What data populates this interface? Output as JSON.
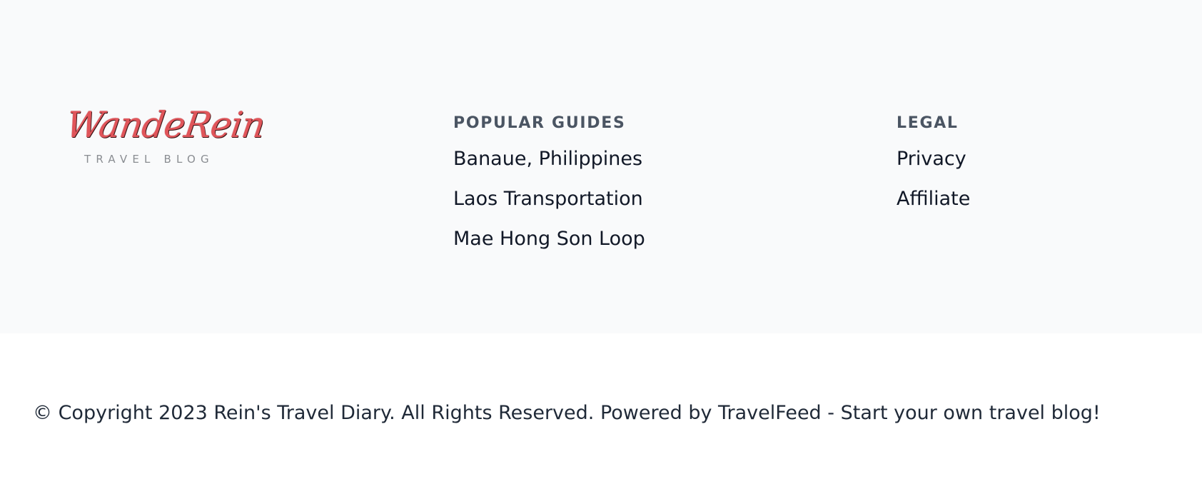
{
  "brand": {
    "logo_text": "WandeRein",
    "logo_subtext": "TRAVEL BLOG",
    "logo_color": "#e0555a"
  },
  "popular_guides": {
    "heading": "POPULAR GUIDES",
    "items": [
      {
        "label": "Banaue, Philippines"
      },
      {
        "label": "Laos Transportation"
      },
      {
        "label": "Mae Hong Son Loop"
      }
    ]
  },
  "legal": {
    "heading": "LEGAL",
    "items": [
      {
        "label": "Privacy"
      },
      {
        "label": "Affiliate"
      }
    ]
  },
  "copyright": {
    "text": "© Copyright 2023 Rein's Travel Diary. All Rights Reserved. Powered by TravelFeed - Start your own travel blog!"
  },
  "colors": {
    "footer_background": "#f9fafb",
    "heading_text": "#4b5563",
    "link_text": "#111827"
  }
}
